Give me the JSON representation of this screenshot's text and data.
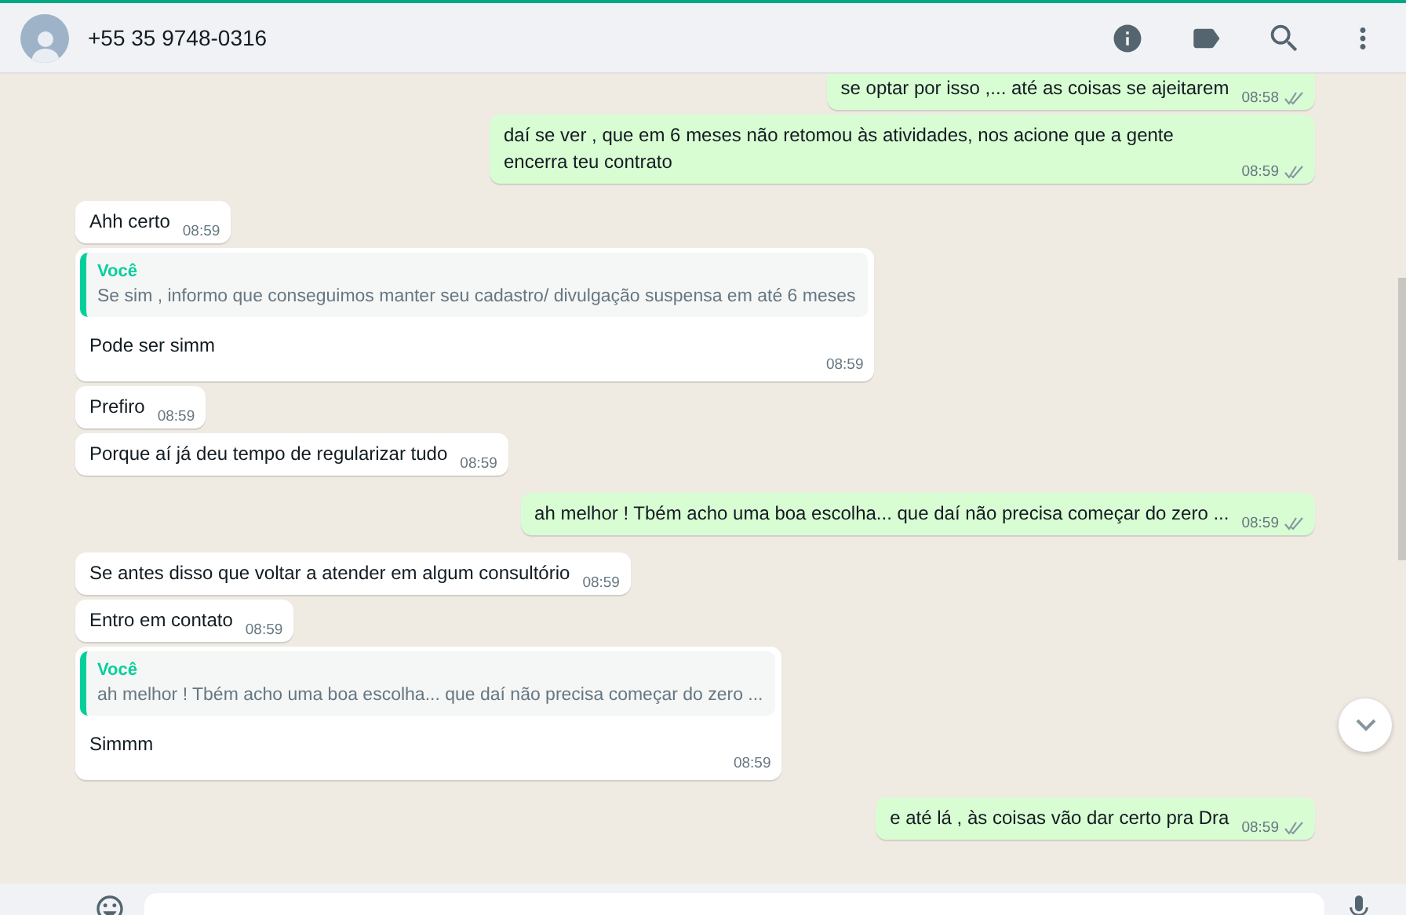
{
  "header": {
    "contact": "+55 35 9748-0316"
  },
  "messages": [
    {
      "outgoing": true,
      "text": "se optar por isso ,... até as coisas se ajeitarem",
      "time": "08:58",
      "read": false
    },
    {
      "outgoing": true,
      "text": "daí se ver , que em 6 meses não retomou às atividades, nos acione que a gente encerra teu contrato",
      "time": "08:59",
      "read": false
    },
    {
      "outgoing": false,
      "text": "Ahh certo",
      "time": "08:59"
    },
    {
      "outgoing": false,
      "text": "Pode ser simm",
      "time": "08:59",
      "quote": {
        "author": "Você",
        "text": "Se sim , informo que conseguimos manter seu cadastro/ divulgação suspensa em até 6 meses"
      }
    },
    {
      "outgoing": false,
      "text": "Prefiro",
      "time": "08:59"
    },
    {
      "outgoing": false,
      "text": "Porque aí já deu tempo de regularizar tudo",
      "time": "08:59"
    },
    {
      "outgoing": true,
      "text": "ah melhor ! Tbém acho uma boa escolha... que daí não precisa começar do zero ...",
      "time": "08:59",
      "read": false
    },
    {
      "outgoing": false,
      "text": "Se antes disso que voltar a atender em algum consultório",
      "time": "08:59"
    },
    {
      "outgoing": false,
      "text": "Entro em contato",
      "time": "08:59"
    },
    {
      "outgoing": false,
      "text": "Simmm",
      "time": "08:59",
      "quote": {
        "author": "Você",
        "text": "ah melhor ! Tbém acho uma boa escolha... que daí não precisa começar do zero ..."
      }
    },
    {
      "outgoing": true,
      "text": "e até lá , às coisas vão dar certo pra Dra",
      "time": "08:59",
      "read": false
    }
  ]
}
